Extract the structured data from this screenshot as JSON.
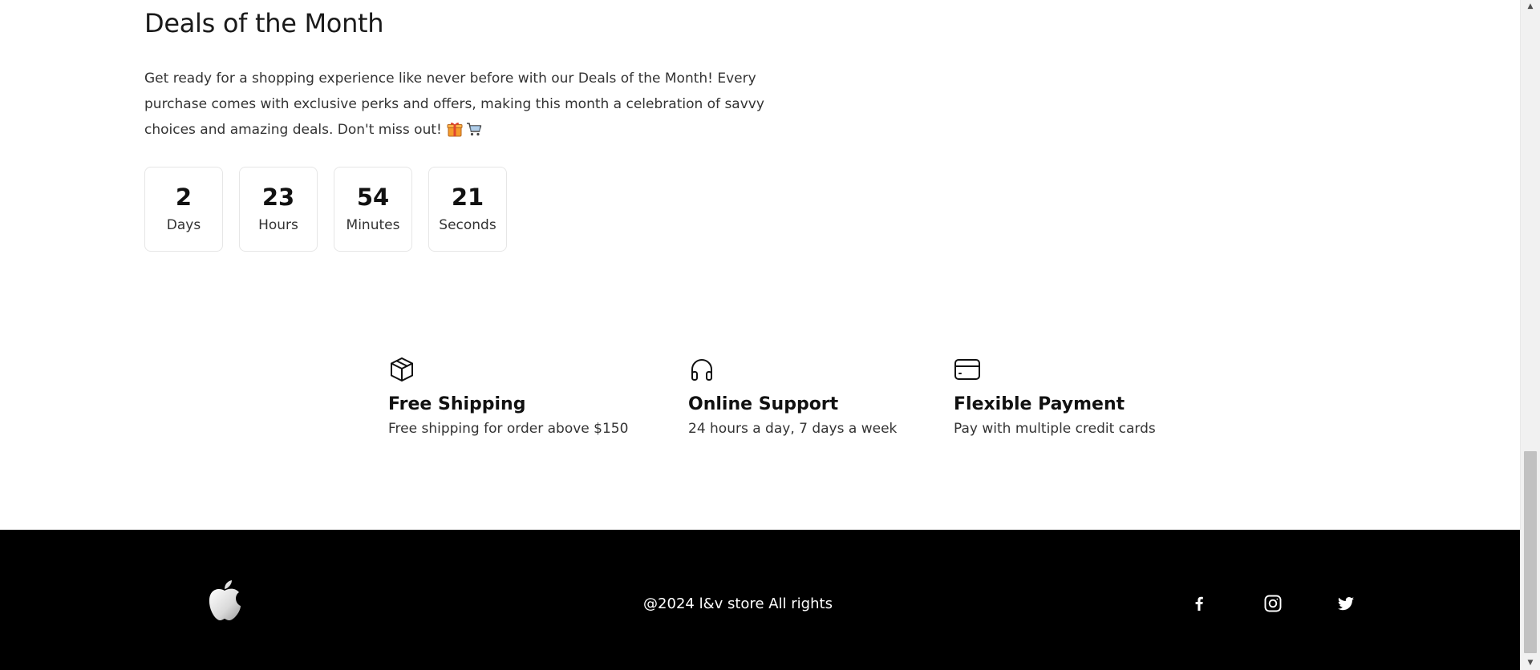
{
  "deals": {
    "title": "Deals of the Month",
    "description": "Get ready for a shopping experience like never before with our Deals of the Month! Every purchase comes with exclusive perks and offers, making this month a celebration of savvy choices and amazing deals. Don't miss out!",
    "emoji_icons": [
      "gift-icon",
      "shopping-cart-icon"
    ]
  },
  "countdown": [
    {
      "value": "2",
      "label": "Days"
    },
    {
      "value": "23",
      "label": "Hours"
    },
    {
      "value": "54",
      "label": "Minutes"
    },
    {
      "value": "21",
      "label": "Seconds"
    }
  ],
  "features": [
    {
      "icon": "package-icon",
      "title": "Free Shipping",
      "subtitle": "Free shipping for order above $150"
    },
    {
      "icon": "headphones-icon",
      "title": "Online Support",
      "subtitle": "24 hours a day, 7 days a week"
    },
    {
      "icon": "credit-card-icon",
      "title": "Flexible Payment",
      "subtitle": "Pay with multiple credit cards"
    }
  ],
  "footer": {
    "logo_icon": "apple-logo-icon",
    "copyright": "@2024 l&v store All rights",
    "social_icons": [
      "facebook-icon",
      "instagram-icon",
      "twitter-icon"
    ],
    "background": "#000000",
    "text_color": "#ffffff"
  },
  "scrollbar": {
    "up_glyph": "▲",
    "down_glyph": "▼"
  }
}
